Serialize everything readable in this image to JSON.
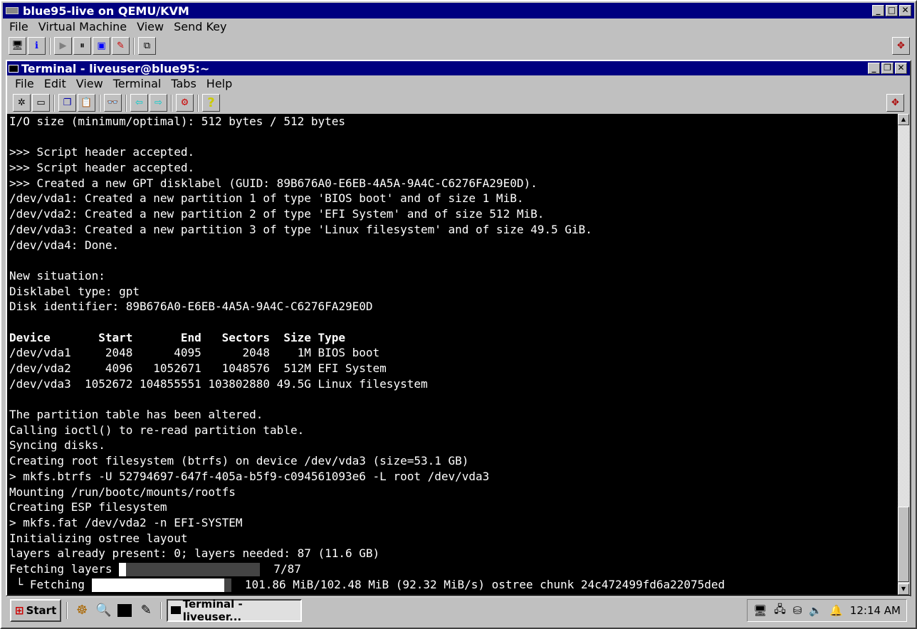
{
  "vm_window": {
    "title": "blue95-live on QEMU/KVM",
    "menu": [
      "File",
      "Virtual Machine",
      "View",
      "Send Key"
    ],
    "toolbar_icons": [
      "console-icon",
      "details-icon",
      "run-icon",
      "pause-icon",
      "shutdown-icon",
      "snapshot-icon",
      "fullscreen-icon"
    ],
    "scale_icon": "resize-icon"
  },
  "terminal_window": {
    "title": "Terminal - liveuser@blue95:~",
    "menu": [
      "File",
      "Edit",
      "View",
      "Terminal",
      "Tabs",
      "Help"
    ],
    "toolbar_icons": [
      "new-tab-icon",
      "new-window-icon",
      "copy-icon",
      "paste-icon",
      "find-icon",
      "prev-tab-icon",
      "next-tab-icon",
      "preferences-icon",
      "help-icon"
    ]
  },
  "terminal": {
    "lines": [
      "I/O size (minimum/optimal): 512 bytes / 512 bytes",
      "",
      ">>> Script header accepted.",
      ">>> Script header accepted.",
      ">>> Created a new GPT disklabel (GUID: 89B676A0-E6EB-4A5A-9A4C-C6276FA29E0D).",
      "/dev/vda1: Created a new partition 1 of type 'BIOS boot' and of size 1 MiB.",
      "/dev/vda2: Created a new partition 2 of type 'EFI System' and of size 512 MiB.",
      "/dev/vda3: Created a new partition 3 of type 'Linux filesystem' and of size 49.5 GiB.",
      "/dev/vda4: Done.",
      "",
      "New situation:",
      "Disklabel type: gpt",
      "Disk identifier: 89B676A0-E6EB-4A5A-9A4C-C6276FA29E0D",
      "",
      "Device       Start       End   Sectors  Size Type",
      "/dev/vda1     2048      4095      2048    1M BIOS boot",
      "/dev/vda2     4096   1052671   1048576  512M EFI System",
      "/dev/vda3  1052672 104855551 103802880 49.5G Linux filesystem",
      "",
      "The partition table has been altered.",
      "Calling ioctl() to re-read partition table.",
      "Syncing disks.",
      "Creating root filesystem (btrfs) on device /dev/vda3 (size=53.1 GB)",
      "> mkfs.btrfs -U 52794697-647f-405a-b5f9-c094561093e6 -L root /dev/vda3",
      "Mounting /run/bootc/mounts/rootfs",
      "Creating ESP filesystem",
      "> mkfs.fat /dev/vda2 -n EFI-SYSTEM",
      "Initializing ostree layout",
      "layers already present: 0; layers needed: 87 (11.6 GB)"
    ],
    "bold_line_index": 14,
    "progress_layers": {
      "label": "Fetching layers",
      "count": "7/87",
      "fraction": 0.05
    },
    "progress_chunk": {
      "prefix": " └ Fetching",
      "fraction": 0.95,
      "status": "101.86 MiB/102.48 MiB (92.32 MiB/s) ostree chunk 24c472499fd6a22075ded"
    }
  },
  "taskbar": {
    "start_label": "Start",
    "quick_launch": [
      "helm-icon",
      "file-search-icon",
      "terminal-icon",
      "editor-icon"
    ],
    "task_label": "Terminal - liveuser...",
    "tray_icons": [
      "display-icon",
      "network-icon",
      "usb-icon",
      "volume-icon",
      "notification-bell-icon"
    ],
    "clock": "12:14 AM"
  }
}
